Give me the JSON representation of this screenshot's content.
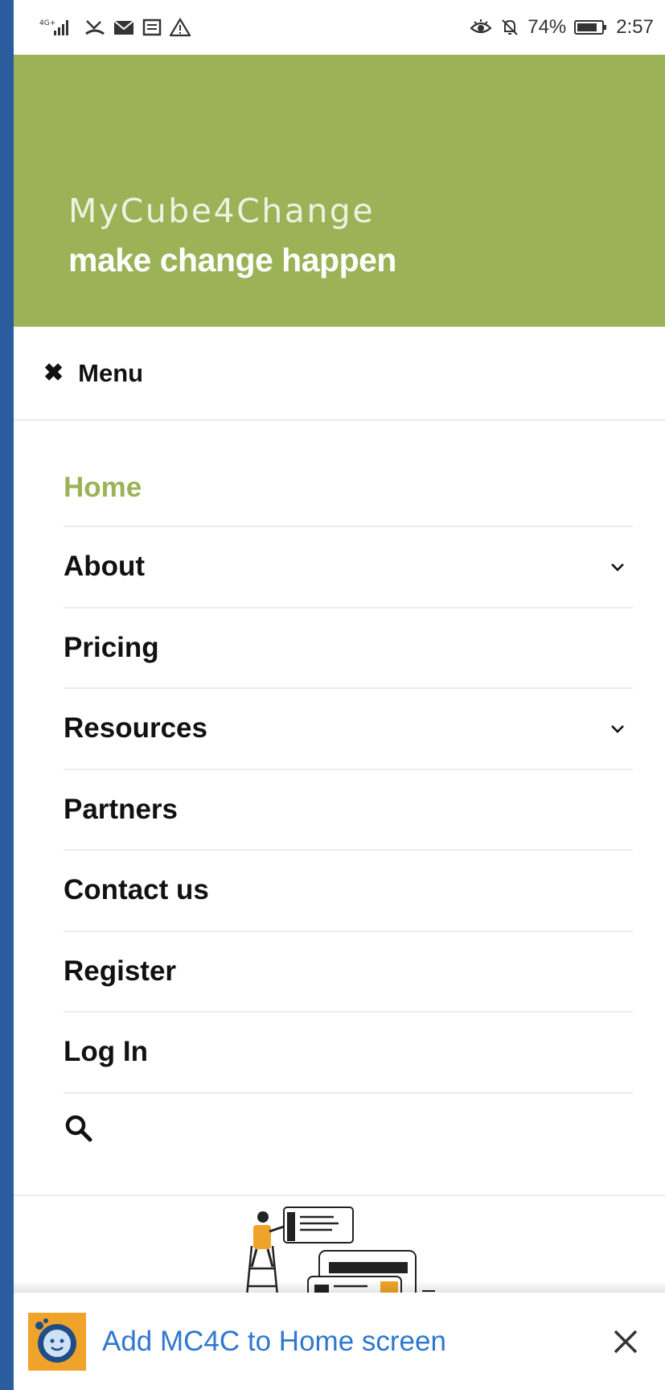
{
  "status_bar": {
    "network": "4G+",
    "battery_percent": "74%",
    "time": "2:57"
  },
  "header": {
    "site_title": "MyCube4Change",
    "tagline": "make change happen"
  },
  "menu_toggle": {
    "icon": "close-icon",
    "label": "Menu"
  },
  "nav": {
    "items": [
      {
        "label": "Home",
        "active": true,
        "has_submenu": false
      },
      {
        "label": "About",
        "active": false,
        "has_submenu": true
      },
      {
        "label": "Pricing",
        "active": false,
        "has_submenu": false
      },
      {
        "label": "Resources",
        "active": false,
        "has_submenu": true
      },
      {
        "label": "Partners",
        "active": false,
        "has_submenu": false
      },
      {
        "label": "Contact us",
        "active": false,
        "has_submenu": false
      },
      {
        "label": "Register",
        "active": false,
        "has_submenu": false
      },
      {
        "label": "Log In",
        "active": false,
        "has_submenu": false
      }
    ],
    "search_icon": "search-icon"
  },
  "banner": {
    "text": "Add MC4C to Home screen",
    "close_icon": "close-icon"
  },
  "colors": {
    "brand_green": "#9bb256",
    "link_blue": "#2f77d0",
    "edge_blue": "#2b5c9e"
  }
}
